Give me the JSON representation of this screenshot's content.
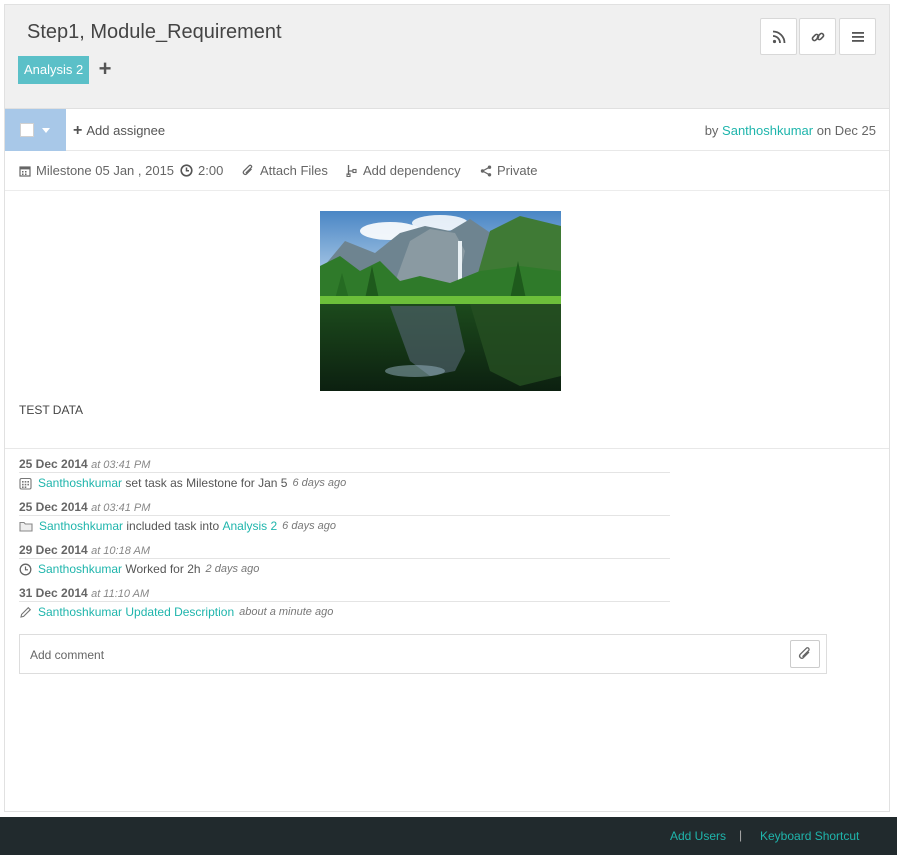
{
  "header": {
    "title": "Step1, Module_Requirement",
    "tag": "Analysis 2",
    "rss_icon": "rss-icon",
    "link_icon": "link-icon",
    "menu_icon": "menu-icon"
  },
  "toolbar": {
    "add_assignee": "Add assignee",
    "by_prefix": "by",
    "author": "Santhoshkumar",
    "on_date": "on Dec 25"
  },
  "meta": {
    "milestone": "Milestone 05 Jan , 2015",
    "time": "2:00",
    "attach": "Attach Files",
    "dependency": "Add dependency",
    "privacy": "Private"
  },
  "description": "TEST DATA",
  "activity": [
    {
      "date": "25 Dec 2014",
      "time": "at 03:41 PM",
      "user": "Santhoshkumar",
      "text": "set task as Milestone for Jan 5",
      "link": "",
      "ago": "6 days ago",
      "icon": "calendar-icon"
    },
    {
      "date": "25 Dec 2014",
      "time": "at 03:41 PM",
      "user": "Santhoshkumar",
      "text": "included task into",
      "link": "Analysis 2",
      "ago": "6 days ago",
      "icon": "folder-icon"
    },
    {
      "date": "29 Dec 2014",
      "time": "at 10:18 AM",
      "user": "Santhoshkumar",
      "text": "Worked for 2h",
      "link": "",
      "ago": "2 days ago",
      "icon": "clock-icon"
    },
    {
      "date": "31 Dec 2014",
      "time": "at 11:10 AM",
      "user": "Santhoshkumar",
      "text": "",
      "link": "Updated Description",
      "ago": "about a minute ago",
      "icon": "pencil-icon"
    }
  ],
  "comment": {
    "placeholder": "Add comment"
  },
  "footer": {
    "add_users": "Add Users",
    "separator": "|",
    "keyboard": "Keyboard Shortcut"
  },
  "colors": {
    "accent": "#1fb5ac",
    "tag_bg": "#5bc0c8",
    "footer_bg": "#212a2d",
    "checkbox_bg": "#a8c8e8"
  }
}
